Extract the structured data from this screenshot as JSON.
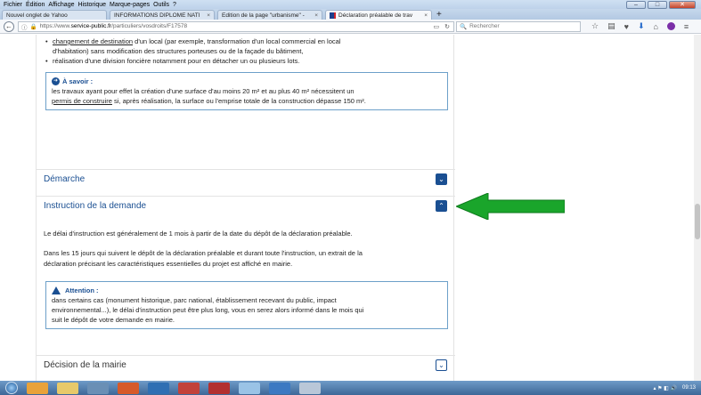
{
  "menubar": {
    "items": [
      "Fichier",
      "Édition",
      "Affichage",
      "Historique",
      "Marque-pages",
      "Outils",
      "?"
    ]
  },
  "tabs": [
    {
      "label": "Nouvel onglet de Yahoo",
      "close": ""
    },
    {
      "label": "INFORMATIONS DIPLOME NATI",
      "close": "×"
    },
    {
      "label": "Edition de la page \"urbanisme\" -",
      "close": "×"
    },
    {
      "label": "Déclaration préalable de trav",
      "close": "×"
    }
  ],
  "new_tab": "+",
  "navbar": {
    "url_prefix": "https://www.",
    "url_host": "service-public.fr",
    "url_path": "/particuliers/vosdroits/F17578",
    "search_placeholder": "Rechercher"
  },
  "content": {
    "bullet1_link": "changement de destination",
    "bullet1_rest": " d'un local (par exemple, transformation d'un local commercial en local",
    "bullet1_line2": "d'habitation) sans modification des structures porteuses ou de la façade du bâtiment,",
    "bullet2": "réalisation d'une division foncière notamment pour en détacher un ou plusieurs lots.",
    "savoir_title": "À savoir :",
    "savoir_line1": "les travaux ayant pour effet la création d'une surface d'au moins 20 m² et au plus 40 m² nécessitent un",
    "savoir_link": "permis de construire",
    "savoir_line2": " si, après réalisation, la surface ou l'emprise totale de la construction dépasse 150 m².",
    "demarche_label": "Démarche",
    "instruction_label": "Instruction de la demande",
    "instr_para1": "Le délai d'instruction est généralement de 1 mois à partir de la date du dépôt de la déclaration préalable.",
    "instr_para2_line1": "Dans les 15 jours qui suivent le dépôt de la déclaration préalable et durant toute l'instruction, un extrait de la",
    "instr_para2_line2": "déclaration précisant les caractéristiques essentielles du projet est affiché en mairie.",
    "attention_title": "Attention :",
    "attention_line1": "dans certains cas (monument historique, parc national, établissement recevant du public, impact",
    "attention_line2": "environnemental...), le délai d'instruction peut être plus long, vous en serez alors informé dans le mois qui",
    "attention_line3": "suit le dépôt de votre demande en mairie.",
    "decision_label": "Décision de la mairie"
  },
  "taskbar": {
    "time": "09:13"
  },
  "colors": {
    "accent": "#1a4f92",
    "arrow": "#1aa52b"
  }
}
